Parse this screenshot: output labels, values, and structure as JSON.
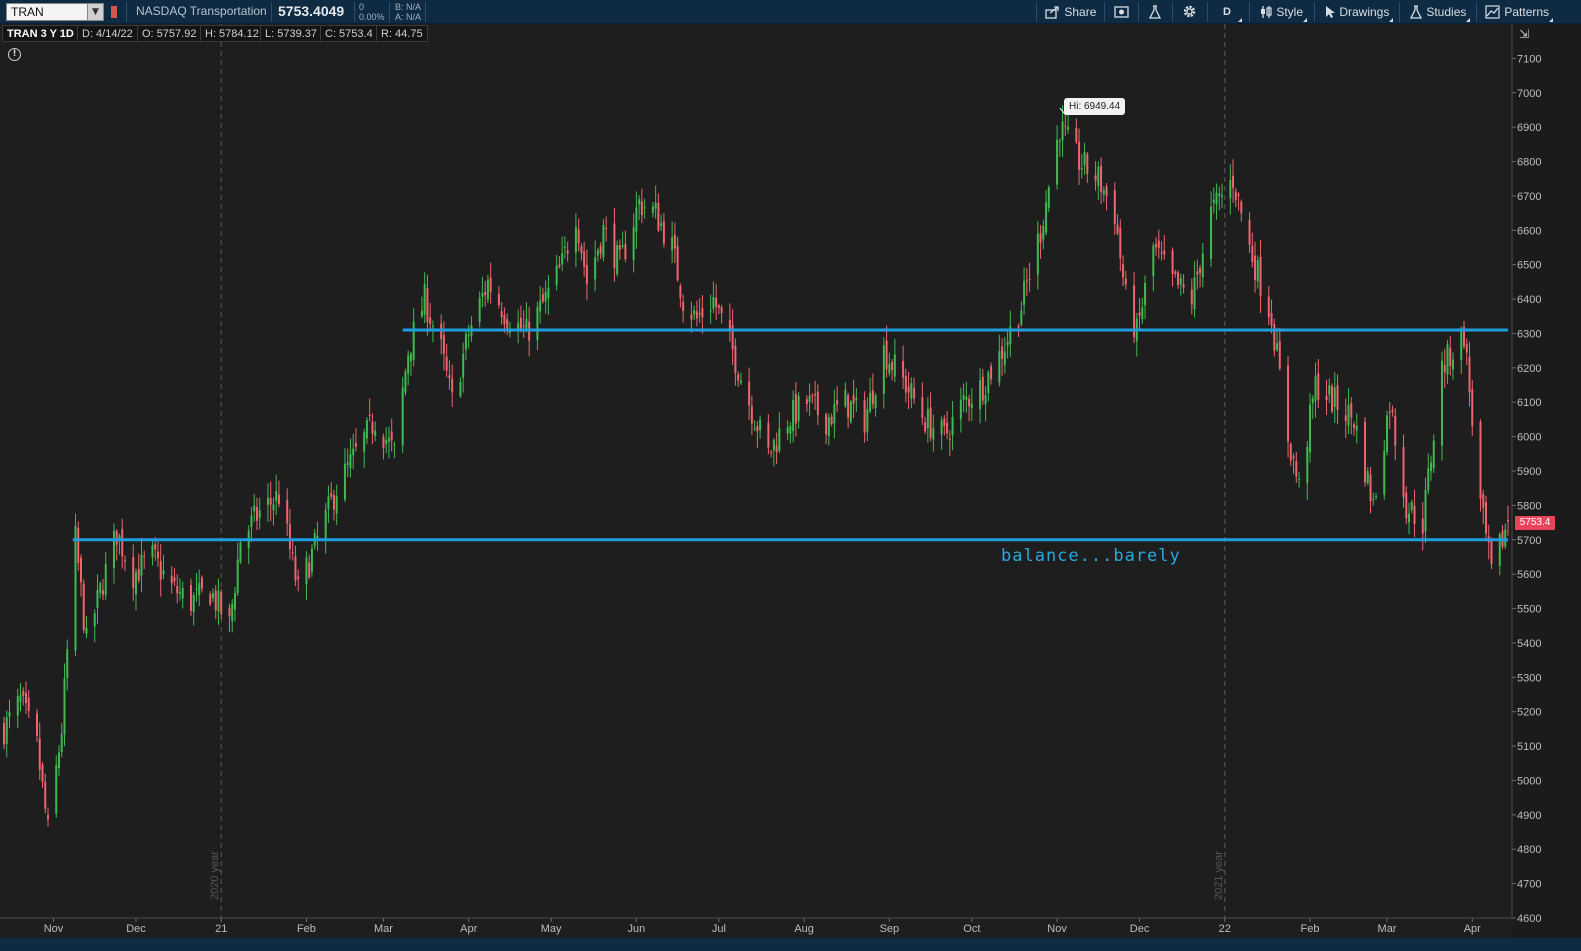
{
  "toolbar": {
    "symbol": "TRAN",
    "dropdown_glyph": "▼",
    "company_name": "NASDAQ Transportation",
    "last_price": "5753.4049",
    "net_change": "0",
    "pct_change": "0.00%",
    "bid": "B: N/A",
    "ask": "A: N/A",
    "share_label": "Share",
    "aggregation_label": "D",
    "style_label": "Style",
    "drawings_label": "Drawings",
    "studies_label": "Studies",
    "patterns_label": "Patterns",
    "icons": [
      "share-icon",
      "snapshot-icon",
      "flask-icon",
      "gear-icon",
      "style-icon",
      "cursor-icon",
      "studies-flask-icon",
      "patterns-icon"
    ]
  },
  "infobar": {
    "title": "TRAN 3 Y 1D",
    "date": "D: 4/14/22",
    "open": "O: 5757.92",
    "high": "H: 5784.12",
    "low": "L: 5739.37",
    "close": "C: 5753.4",
    "range": "R: 44.75"
  },
  "colors": {
    "background": "#1e1e1e",
    "toolbar": "#0f2b44",
    "up_candle": "#3fb950",
    "down_candle": "#f0646e",
    "trendline": "#1e9de0",
    "price_tag": "#e8455a",
    "grid_line": "#5a5a5a"
  },
  "chart_data": {
    "type": "candlestick",
    "symbol": "TRAN",
    "ylim": [
      4600,
      7200
    ],
    "y_ticks": [
      4600,
      4700,
      4800,
      4900,
      5000,
      5100,
      5200,
      5300,
      5400,
      5500,
      5600,
      5700,
      5800,
      5900,
      6000,
      6100,
      6200,
      6300,
      6400,
      6500,
      6600,
      6700,
      6800,
      6900,
      7000,
      7100
    ],
    "x_range": [
      "2020-10-14",
      "2022-04-14"
    ],
    "x_ticks": [
      {
        "date": "2020-11-01",
        "label": "Nov"
      },
      {
        "date": "2020-12-01",
        "label": "Dec"
      },
      {
        "date": "2021-01-01",
        "label": "21"
      },
      {
        "date": "2021-02-01",
        "label": "Feb"
      },
      {
        "date": "2021-03-01",
        "label": "Mar"
      },
      {
        "date": "2021-04-01",
        "label": "Apr"
      },
      {
        "date": "2021-05-01",
        "label": "May"
      },
      {
        "date": "2021-06-01",
        "label": "Jun"
      },
      {
        "date": "2021-07-01",
        "label": "Jul"
      },
      {
        "date": "2021-08-01",
        "label": "Aug"
      },
      {
        "date": "2021-09-01",
        "label": "Sep"
      },
      {
        "date": "2021-10-01",
        "label": "Oct"
      },
      {
        "date": "2021-11-01",
        "label": "Nov"
      },
      {
        "date": "2021-12-01",
        "label": "Dec"
      },
      {
        "date": "2022-01-01",
        "label": "22"
      },
      {
        "date": "2022-02-01",
        "label": "Feb"
      },
      {
        "date": "2022-03-01",
        "label": "Mar"
      },
      {
        "date": "2022-04-01",
        "label": "Apr"
      }
    ],
    "year_separators": [
      {
        "date": "2021-01-01",
        "label": "2020 year"
      },
      {
        "date": "2022-01-01",
        "label": "2021 year"
      }
    ],
    "close_path": [
      [
        "2020-10-14",
        5150
      ],
      [
        "2020-10-20",
        5230
      ],
      [
        "2020-10-26",
        5100
      ],
      [
        "2020-10-30",
        4850
      ],
      [
        "2020-11-04",
        5150
      ],
      [
        "2020-11-09",
        5700
      ],
      [
        "2020-11-13",
        5400
      ],
      [
        "2020-11-18",
        5550
      ],
      [
        "2020-11-24",
        5720
      ],
      [
        "2020-11-30",
        5600
      ],
      [
        "2020-12-07",
        5650
      ],
      [
        "2020-12-14",
        5560
      ],
      [
        "2020-12-21",
        5520
      ],
      [
        "2020-12-28",
        5550
      ],
      [
        "2021-01-04",
        5450
      ],
      [
        "2021-01-08",
        5700
      ],
      [
        "2021-01-15",
        5780
      ],
      [
        "2021-01-22",
        5830
      ],
      [
        "2021-01-29",
        5550
      ],
      [
        "2021-02-05",
        5700
      ],
      [
        "2021-02-12",
        5850
      ],
      [
        "2021-02-19",
        5950
      ],
      [
        "2021-02-26",
        6050
      ],
      [
        "2021-03-05",
        5950
      ],
      [
        "2021-03-10",
        6250
      ],
      [
        "2021-03-16",
        6400
      ],
      [
        "2021-03-22",
        6250
      ],
      [
        "2021-03-26",
        6100
      ],
      [
        "2021-04-01",
        6300
      ],
      [
        "2021-04-08",
        6450
      ],
      [
        "2021-04-15",
        6350
      ],
      [
        "2021-04-22",
        6300
      ],
      [
        "2021-04-29",
        6400
      ],
      [
        "2021-05-05",
        6500
      ],
      [
        "2021-05-10",
        6650
      ],
      [
        "2021-05-14",
        6450
      ],
      [
        "2021-05-20",
        6600
      ],
      [
        "2021-05-26",
        6500
      ],
      [
        "2021-06-02",
        6680
      ],
      [
        "2021-06-08",
        6650
      ],
      [
        "2021-06-14",
        6550
      ],
      [
        "2021-06-18",
        6400
      ],
      [
        "2021-06-23",
        6340
      ],
      [
        "2021-06-29",
        6400
      ],
      [
        "2021-07-06",
        6250
      ],
      [
        "2021-07-12",
        6100
      ],
      [
        "2021-07-19",
        5950
      ],
      [
        "2021-07-26",
        6050
      ],
      [
        "2021-08-02",
        6100
      ],
      [
        "2021-08-09",
        6050
      ],
      [
        "2021-08-16",
        6100
      ],
      [
        "2021-08-23",
        6050
      ],
      [
        "2021-08-30",
        6250
      ],
      [
        "2021-09-07",
        6150
      ],
      [
        "2021-09-14",
        6050
      ],
      [
        "2021-09-21",
        6000
      ],
      [
        "2021-09-28",
        6100
      ],
      [
        "2021-10-05",
        6150
      ],
      [
        "2021-10-12",
        6250
      ],
      [
        "2021-10-19",
        6380
      ],
      [
        "2021-10-26",
        6600
      ],
      [
        "2021-11-02",
        6900
      ],
      [
        "2021-11-09",
        6800
      ],
      [
        "2021-11-16",
        6750
      ],
      [
        "2021-11-22",
        6650
      ],
      [
        "2021-11-26",
        6400
      ],
      [
        "2021-11-30",
        6300
      ],
      [
        "2021-12-06",
        6550
      ],
      [
        "2021-12-13",
        6450
      ],
      [
        "2021-12-20",
        6400
      ],
      [
        "2021-12-27",
        6650
      ],
      [
        "2022-01-04",
        6750
      ],
      [
        "2022-01-10",
        6550
      ],
      [
        "2022-01-18",
        6350
      ],
      [
        "2022-01-24",
        6000
      ],
      [
        "2022-01-28",
        5850
      ],
      [
        "2022-02-03",
        6150
      ],
      [
        "2022-02-10",
        6100
      ],
      [
        "2022-02-17",
        6050
      ],
      [
        "2022-02-24",
        5800
      ],
      [
        "2022-03-02",
        6100
      ],
      [
        "2022-03-08",
        5800
      ],
      [
        "2022-03-14",
        5750
      ],
      [
        "2022-03-21",
        6200
      ],
      [
        "2022-03-29",
        6300
      ],
      [
        "2022-04-04",
        5800
      ],
      [
        "2022-04-08",
        5600
      ],
      [
        "2022-04-14",
        5753.4
      ]
    ],
    "trendlines": [
      {
        "from": [
          "2021-03-08",
          6310
        ],
        "to": [
          "2022-04-14",
          6310
        ]
      },
      {
        "from": [
          "2020-11-08",
          5700
        ],
        "to": [
          "2022-04-14",
          5700
        ]
      }
    ],
    "high_marker": {
      "date": "2021-11-02",
      "value": 6949.44,
      "label": "Hi: 6949.44"
    },
    "last_price_tag": "5753.4",
    "annotation": "balance...barely"
  }
}
